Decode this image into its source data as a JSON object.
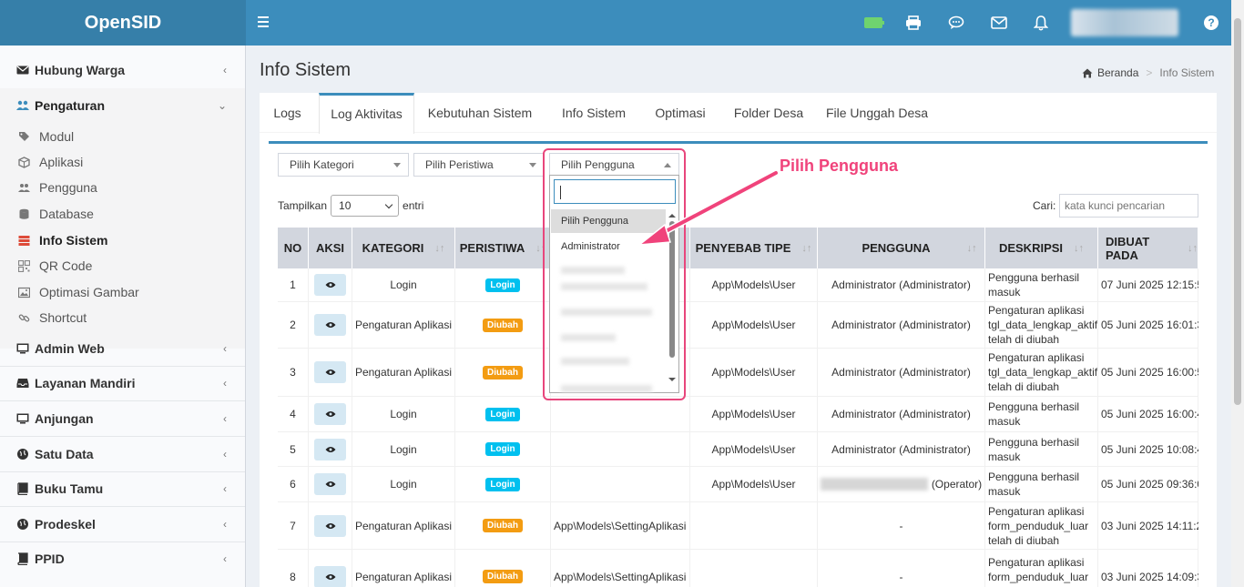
{
  "header": {
    "logo": "OpenSID",
    "icons": [
      "battery-icon",
      "print-icon",
      "chat-icon",
      "mail-icon",
      "bell-icon",
      "help-icon"
    ],
    "colors": {
      "primary": "#3c8dbc",
      "logo_bg": "#367fa9",
      "accent": "#f0437b"
    }
  },
  "sidebar": {
    "items": [
      {
        "label": "Hubung Warga",
        "icon": "envelope-icon"
      },
      {
        "label": "Pengaturan",
        "icon": "users-icon",
        "expanded": true
      },
      {
        "label": "Admin Web",
        "icon": "monitor-icon"
      },
      {
        "label": "Layanan Mandiri",
        "icon": "inbox-icon"
      },
      {
        "label": "Anjungan",
        "icon": "monitor-icon"
      },
      {
        "label": "Satu Data",
        "icon": "globe-icon"
      },
      {
        "label": "Buku Tamu",
        "icon": "book-icon"
      },
      {
        "label": "Prodeskel",
        "icon": "globe-icon"
      },
      {
        "label": "PPID",
        "icon": "book-icon"
      }
    ],
    "sub_items": [
      {
        "label": "Modul",
        "icon": "tag-icon"
      },
      {
        "label": "Aplikasi",
        "icon": "cube-icon"
      },
      {
        "label": "Pengguna",
        "icon": "users-icon"
      },
      {
        "label": "Database",
        "icon": "database-icon"
      },
      {
        "label": "Info Sistem",
        "icon": "server-icon",
        "active": true
      },
      {
        "label": "QR Code",
        "icon": "qrcode-icon"
      },
      {
        "label": "Optimasi Gambar",
        "icon": "image-icon"
      },
      {
        "label": "Shortcut",
        "icon": "link-icon"
      }
    ]
  },
  "page": {
    "title": "Info Sistem",
    "breadcrumb": [
      "Beranda",
      "Info Sistem"
    ]
  },
  "tabs": [
    "Logs",
    "Log Aktivitas",
    "Kebutuhan Sistem",
    "Info Sistem",
    "Optimasi",
    "Folder Desa",
    "File Unggah Desa"
  ],
  "active_tab": "Log Aktivitas",
  "filters": {
    "kategori": "Pilih Kategori",
    "peristiwa": "Pilih Peristiwa",
    "pengguna": "Pilih Pengguna"
  },
  "dropdown": {
    "options": [
      "Pilih Pengguna",
      "Administrator"
    ],
    "selected": "Pilih Pengguna"
  },
  "annotation": "Pilih Pengguna",
  "table_controls": {
    "show_label": "Tampilkan",
    "show_value": "10",
    "entries_label": "entri",
    "search_label": "Cari:",
    "search_placeholder": "kata kunci pencarian"
  },
  "table": {
    "headers": [
      "NO",
      "AKSI",
      "KATEGORI",
      "PERISTIWA",
      "",
      "PENYEBAB TIPE",
      "PENGGUNA",
      "DESKRIPSI",
      "DIBUAT PADA"
    ],
    "rows": [
      {
        "no": "1",
        "kategori": "Login",
        "peristiwa": "Login",
        "penyebab": "",
        "tipe": "App\\Models\\User",
        "pengguna": "Administrator (Administrator)",
        "deskripsi": "Pengguna berhasil masuk",
        "dibuat": "07 Juni 2025 12:15:5"
      },
      {
        "no": "2",
        "kategori": "Pengaturan Aplikasi",
        "peristiwa": "Diubah",
        "penyebab": "",
        "tipe": "App\\Models\\User",
        "pengguna": "Administrator (Administrator)",
        "deskripsi": "Pengaturan aplikasi tgl_data_lengkap_aktif telah di diubah",
        "dibuat": "05 Juni 2025 16:01:3"
      },
      {
        "no": "3",
        "kategori": "Pengaturan Aplikasi",
        "peristiwa": "Diubah",
        "penyebab": "",
        "tipe": "App\\Models\\User",
        "pengguna": "Administrator (Administrator)",
        "deskripsi": "Pengaturan aplikasi tgl_data_lengkap_aktif telah di diubah",
        "dibuat": "05 Juni 2025 16:00:5"
      },
      {
        "no": "4",
        "kategori": "Login",
        "peristiwa": "Login",
        "penyebab": "",
        "tipe": "App\\Models\\User",
        "pengguna": "Administrator (Administrator)",
        "deskripsi": "Pengguna berhasil masuk",
        "dibuat": "05 Juni 2025 16:00:4"
      },
      {
        "no": "5",
        "kategori": "Login",
        "peristiwa": "Login",
        "penyebab": "",
        "tipe": "App\\Models\\User",
        "pengguna": "Administrator (Administrator)",
        "deskripsi": "Pengguna berhasil masuk",
        "dibuat": "05 Juni 2025 10:08:4"
      },
      {
        "no": "6",
        "kategori": "Login",
        "peristiwa": "Login",
        "penyebab": "",
        "tipe": "App\\Models\\User",
        "pengguna": "(Operator)",
        "deskripsi": "Pengguna berhasil masuk",
        "dibuat": "05 Juni 2025 09:36:0"
      },
      {
        "no": "7",
        "kategori": "Pengaturan Aplikasi",
        "peristiwa": "Diubah",
        "penyebab": "App\\Models\\SettingAplikasi",
        "tipe": "",
        "pengguna": "-",
        "deskripsi": "Pengaturan aplikasi form_penduduk_luar telah di diubah",
        "dibuat": "03 Juni 2025 14:11:2"
      },
      {
        "no": "8",
        "kategori": "Pengaturan Aplikasi",
        "peristiwa": "Diubah",
        "penyebab": "App\\Models\\SettingAplikasi",
        "tipe": "",
        "pengguna": "-",
        "deskripsi": "Pengaturan aplikasi form_penduduk_luar telah di diubah",
        "dibuat": "03 Juni 2025 14:09:3"
      }
    ]
  }
}
